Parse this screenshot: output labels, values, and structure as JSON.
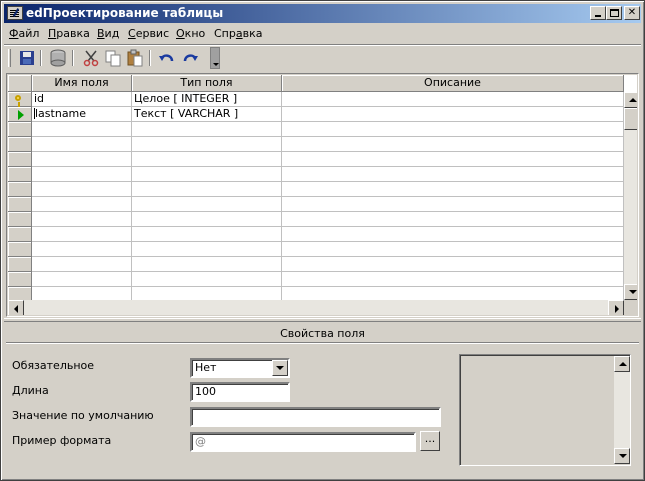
{
  "window": {
    "title": "edПроектирование таблицы",
    "minimize_label": "_",
    "close_label": "✕"
  },
  "menu": [
    {
      "pre": "",
      "ul": "Ф",
      "post": "айл"
    },
    {
      "pre": "",
      "ul": "П",
      "post": "равка"
    },
    {
      "pre": "",
      "ul": "В",
      "post": "ид"
    },
    {
      "pre": "",
      "ul": "С",
      "post": "ервис"
    },
    {
      "pre": "",
      "ul": "О",
      "post": "кно"
    },
    {
      "pre": "Спр",
      "ul": "а",
      "post": "вка"
    }
  ],
  "toolbar": {
    "icons": [
      "save-icon",
      "database-icon",
      "cut-icon",
      "copy-icon",
      "paste-icon",
      "undo-icon",
      "redo-icon"
    ]
  },
  "grid": {
    "columns": [
      "Имя поля",
      "Тип поля",
      "Описание"
    ],
    "rows": [
      {
        "name": "id",
        "type": "Целое [ INTEGER ]",
        "description": ""
      },
      {
        "name": "lastname",
        "type": "Текст [ VARCHAR ]",
        "description": ""
      }
    ]
  },
  "properties": {
    "title": "Свойства поля",
    "required_label": "Обязательное",
    "required_value": "Нет",
    "length_label": "Длина",
    "length_value": "100",
    "default_label": "Значение по умолчанию",
    "default_value": "",
    "format_label": "Пример формата",
    "format_value": "@",
    "ellipsis_label": "..."
  },
  "colors": {
    "title_start": "#0a246a",
    "title_end": "#a6caf0",
    "face": "#d4d0c8"
  }
}
